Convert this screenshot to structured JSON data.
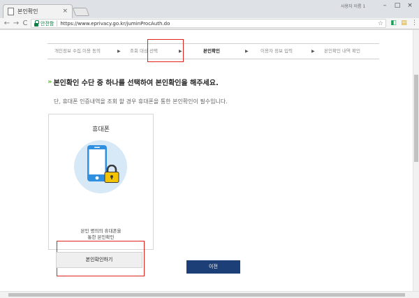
{
  "browser": {
    "tab_title": "본인확인",
    "tab_close": "×",
    "window_user": "사용자 이름 1",
    "win_minimize": "–",
    "win_maximize": "□",
    "win_close": "×",
    "secure_label": "안전함",
    "url": "https://www.eprivacy.go.kr/juminProcAuth.do",
    "back": "←",
    "forward": "→",
    "reload": "C",
    "star": "☆"
  },
  "steps": [
    {
      "label": "개인정보 수집.이용 동의"
    },
    {
      "label": "조회 대상 선택"
    },
    {
      "label": "본인확인"
    },
    {
      "label": "이용자 정보 입력"
    },
    {
      "label": "본인확인 내역 확인"
    }
  ],
  "step_arrow": "▶",
  "heading": {
    "marker": "»",
    "text": "본인확인 수단 중 하나를 선택하여 본인확인을 해주세요."
  },
  "notice": "단, 휴대폰 인증내역을 조회 할 경우 휴대폰을 통한 본인확인이 필수입니다.",
  "card": {
    "title": "휴대폰",
    "desc_line1": "본인 명의의 휴대폰을",
    "desc_line2": "통한 본인확인",
    "button": "본인확인하기"
  },
  "prev_button": "이전",
  "colors": {
    "highlight": "#e2231a",
    "primary_button": "#1c3f78",
    "accent_green": "#6bbd3d"
  },
  "icons": [
    "page-icon",
    "lock-icon",
    "star-icon",
    "chevron-right-icon",
    "smartphone-icon",
    "padlock-icon"
  ]
}
